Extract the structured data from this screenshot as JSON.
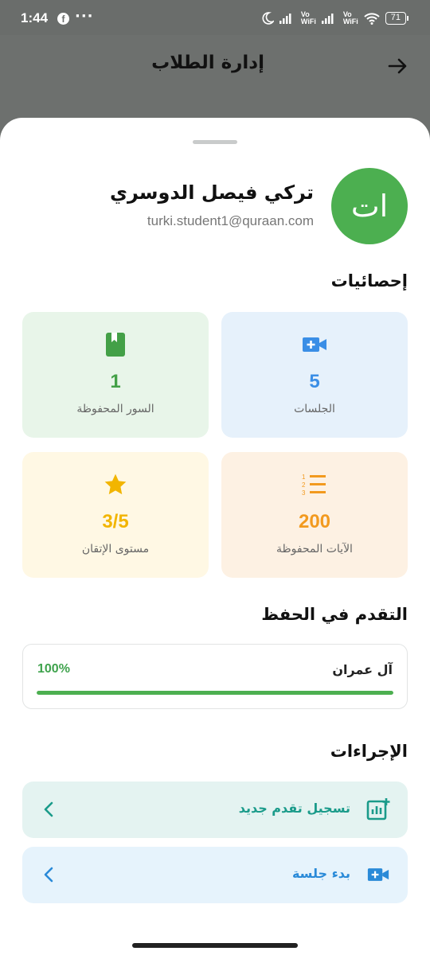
{
  "status_bar": {
    "time": "1:44",
    "notification_icon": "facebook-icon",
    "overflow": "···",
    "vowifi_1": "Vo\nWiFi",
    "vowifi_2": "Vo\nWiFi",
    "battery": "71"
  },
  "app_bar": {
    "title": "إدارة الطلاب",
    "back_icon": "arrow-right-icon"
  },
  "student": {
    "avatar_initials": "ات",
    "name": "تركي فيصل الدوسري",
    "email": "turki.student1@quraan.com"
  },
  "stats": {
    "title": "إحصائيات",
    "cards": [
      {
        "value": "5",
        "label": "الجلسات",
        "icon": "video-add-icon",
        "color": "#3a8ee6",
        "bg": "#e6f1fb"
      },
      {
        "value": "1",
        "label": "السور المحفوظة",
        "icon": "book-icon",
        "color": "#43a047",
        "bg": "#e8f5e9"
      },
      {
        "value": "200",
        "label": "الآيات المحفوظة",
        "icon": "numbered-list-icon",
        "color": "#f29a1f",
        "bg": "#fdf1e3"
      },
      {
        "value": "3/5",
        "label": "مستوى الإتقان",
        "icon": "star-icon",
        "color": "#f2b500",
        "bg": "#fff8e4"
      }
    ]
  },
  "progress": {
    "title": "التقدم في الحفظ",
    "items": [
      {
        "surah": "آل عمران",
        "percent_text": "100%",
        "percent": 100
      }
    ]
  },
  "actions": {
    "title": "الإجراءات",
    "items": [
      {
        "label": "تسجيل تقدم جديد",
        "icon": "chart-add-icon",
        "color": "#1a9b8a",
        "bg": "#e4f3f1"
      },
      {
        "label": "بدء جلسة",
        "icon": "video-add-icon",
        "color": "#2a8ad8",
        "bg": "#e6f3fc"
      }
    ]
  },
  "colors": {
    "accent_green": "#4caf50",
    "overlay": "#6d706e"
  }
}
